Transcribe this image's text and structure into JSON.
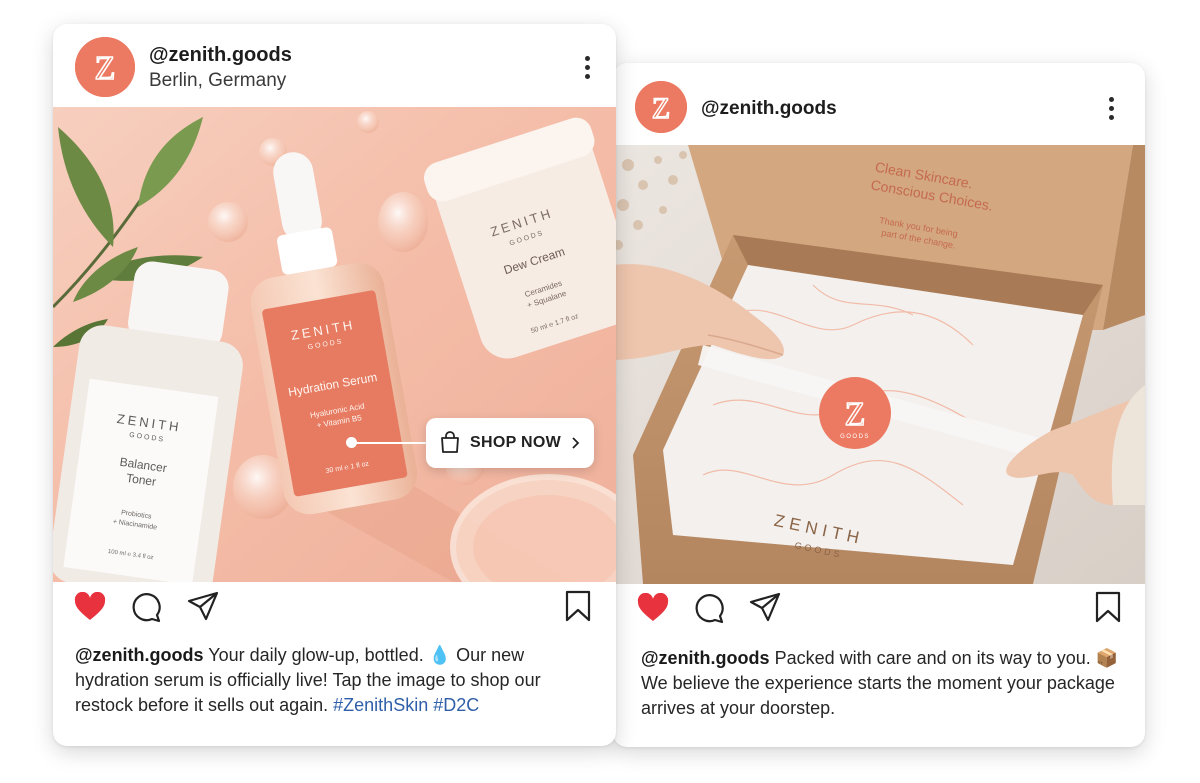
{
  "colors": {
    "brand": "#ec7a62",
    "like": "#e8333f",
    "hashtag": "#2f5fa8"
  },
  "post1": {
    "username": "@zenith.goods",
    "location": "Berlin, Germany",
    "avatar_letter": "Z",
    "icons": [
      "more-icon",
      "heart-icon",
      "comment-icon",
      "share-icon",
      "bookmark-icon",
      "shopping-bag-icon",
      "chevron-right-icon"
    ],
    "shop_label": "SHOP NOW",
    "caption_username": "@zenith.goods",
    "caption_text": "Your daily glow-up, bottled. 💧 Our new hydration serum is officially live! Tap the image to shop our restock before it sells out again.",
    "hashtags": [
      "#ZenithSkin",
      "#D2C"
    ],
    "products": {
      "serum": {
        "brand": "ZENITH",
        "sub": "GOODS",
        "name": "Hydration Serum",
        "detail1": "Hyaluronic Acid",
        "detail2": "+ Vitamin B5",
        "size": "30 ml ℮ 1 fl oz"
      },
      "cream": {
        "brand": "ZENITH",
        "sub": "GOODS",
        "name": "Dew Cream",
        "detail1": "Ceramides",
        "detail2": "+ Squalane",
        "size": "50 ml ℮ 1.7 fl oz"
      },
      "toner": {
        "brand": "ZENITH",
        "sub": "GOODS",
        "name1": "Balancer",
        "name2": "Toner",
        "detail1": "Probiotics",
        "detail2": "+ Niacinamide",
        "size": "100 ml ℮ 3.4 fl oz"
      }
    }
  },
  "post2": {
    "username": "@zenith.goods",
    "avatar_letter": "Z",
    "icons": [
      "more-icon",
      "heart-icon",
      "comment-icon",
      "share-icon",
      "bookmark-icon"
    ],
    "caption_username": "@zenith.goods",
    "caption_text": "Packed with care and on its way to you. 📦 We believe the experience starts the moment your package arrives at your doorstep.",
    "box": {
      "lid_line1": "Clean Skincare.",
      "lid_line2": "Conscious Choices.",
      "lid_small1": "Thank you for being",
      "lid_small2": "part of the change.",
      "front_brand": "ZENITH",
      "front_sub": "GOODS",
      "seal_letter": "Z",
      "seal_sub": "GOODS"
    }
  }
}
